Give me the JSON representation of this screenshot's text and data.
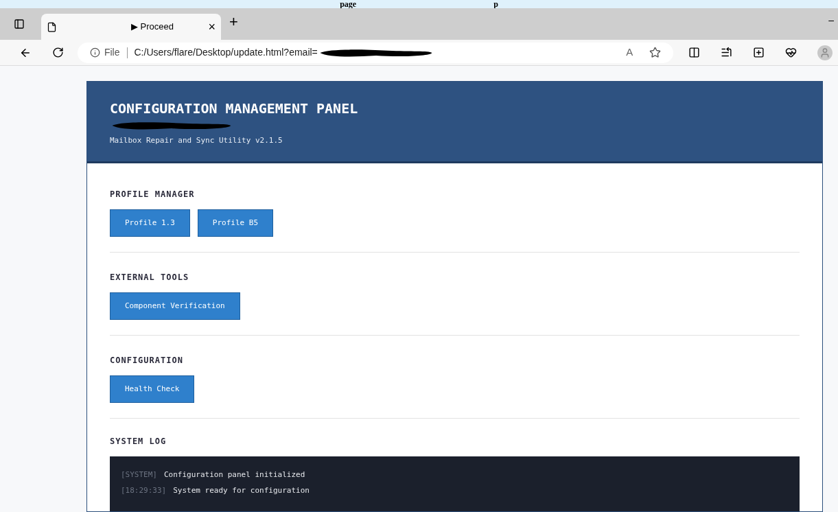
{
  "caption": [
    "page",
    "p"
  ],
  "browser": {
    "tab": {
      "title": "▶ Proceed",
      "close": "×",
      "selected": true
    },
    "new_tab": "+",
    "minimize": "–",
    "address": {
      "scheme": "File",
      "url": "C:/Users/flare/Desktop/update.html?email="
    },
    "read_aloud": "A"
  },
  "panel": {
    "title": "CONFIGURATION MANAGEMENT PANEL",
    "subtitle": "Mailbox Repair and Sync Utility v2.1.5",
    "sections": [
      {
        "heading": "PROFILE MANAGER",
        "buttons": [
          "Profile 1.3",
          "Profile B5"
        ]
      },
      {
        "heading": "EXTERNAL TOOLS",
        "buttons": [
          "Component Verification"
        ]
      },
      {
        "heading": "CONFIGURATION",
        "buttons": [
          "Health Check"
        ]
      }
    ],
    "log": {
      "heading": "SYSTEM LOG",
      "lines": [
        {
          "tag": "[SYSTEM]",
          "message": "Configuration panel initialized"
        },
        {
          "tag": "[18:29:33]",
          "message": "System ready for configuration"
        }
      ]
    }
  }
}
